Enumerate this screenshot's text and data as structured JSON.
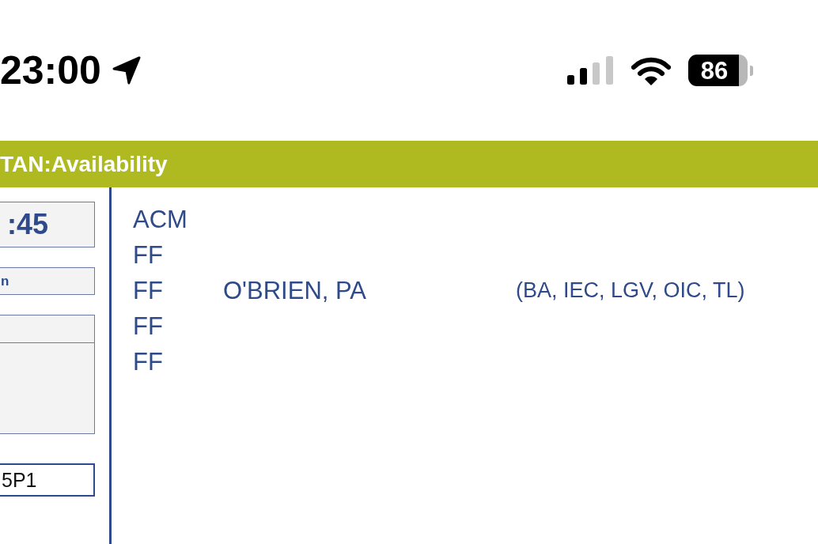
{
  "status_bar": {
    "time": "23:00",
    "battery": "86"
  },
  "header": {
    "title": "TAN:Availability"
  },
  "side_panel": {
    "fields": [
      {
        "kind": "display",
        "value": ":45"
      },
      {
        "kind": "text",
        "value": "n"
      },
      {
        "kind": "blank"
      },
      {
        "kind": "area"
      },
      {
        "kind": "input",
        "value": "5P1"
      }
    ]
  },
  "roster": {
    "rows": [
      {
        "code": "ACM"
      },
      {
        "code": "FF"
      },
      {
        "code": "FF",
        "name": "O'BRIEN, PA",
        "qualifications": "(BA, IEC, LGV, OIC, TL)"
      },
      {
        "code": "FF"
      },
      {
        "code": "FF"
      }
    ]
  }
}
